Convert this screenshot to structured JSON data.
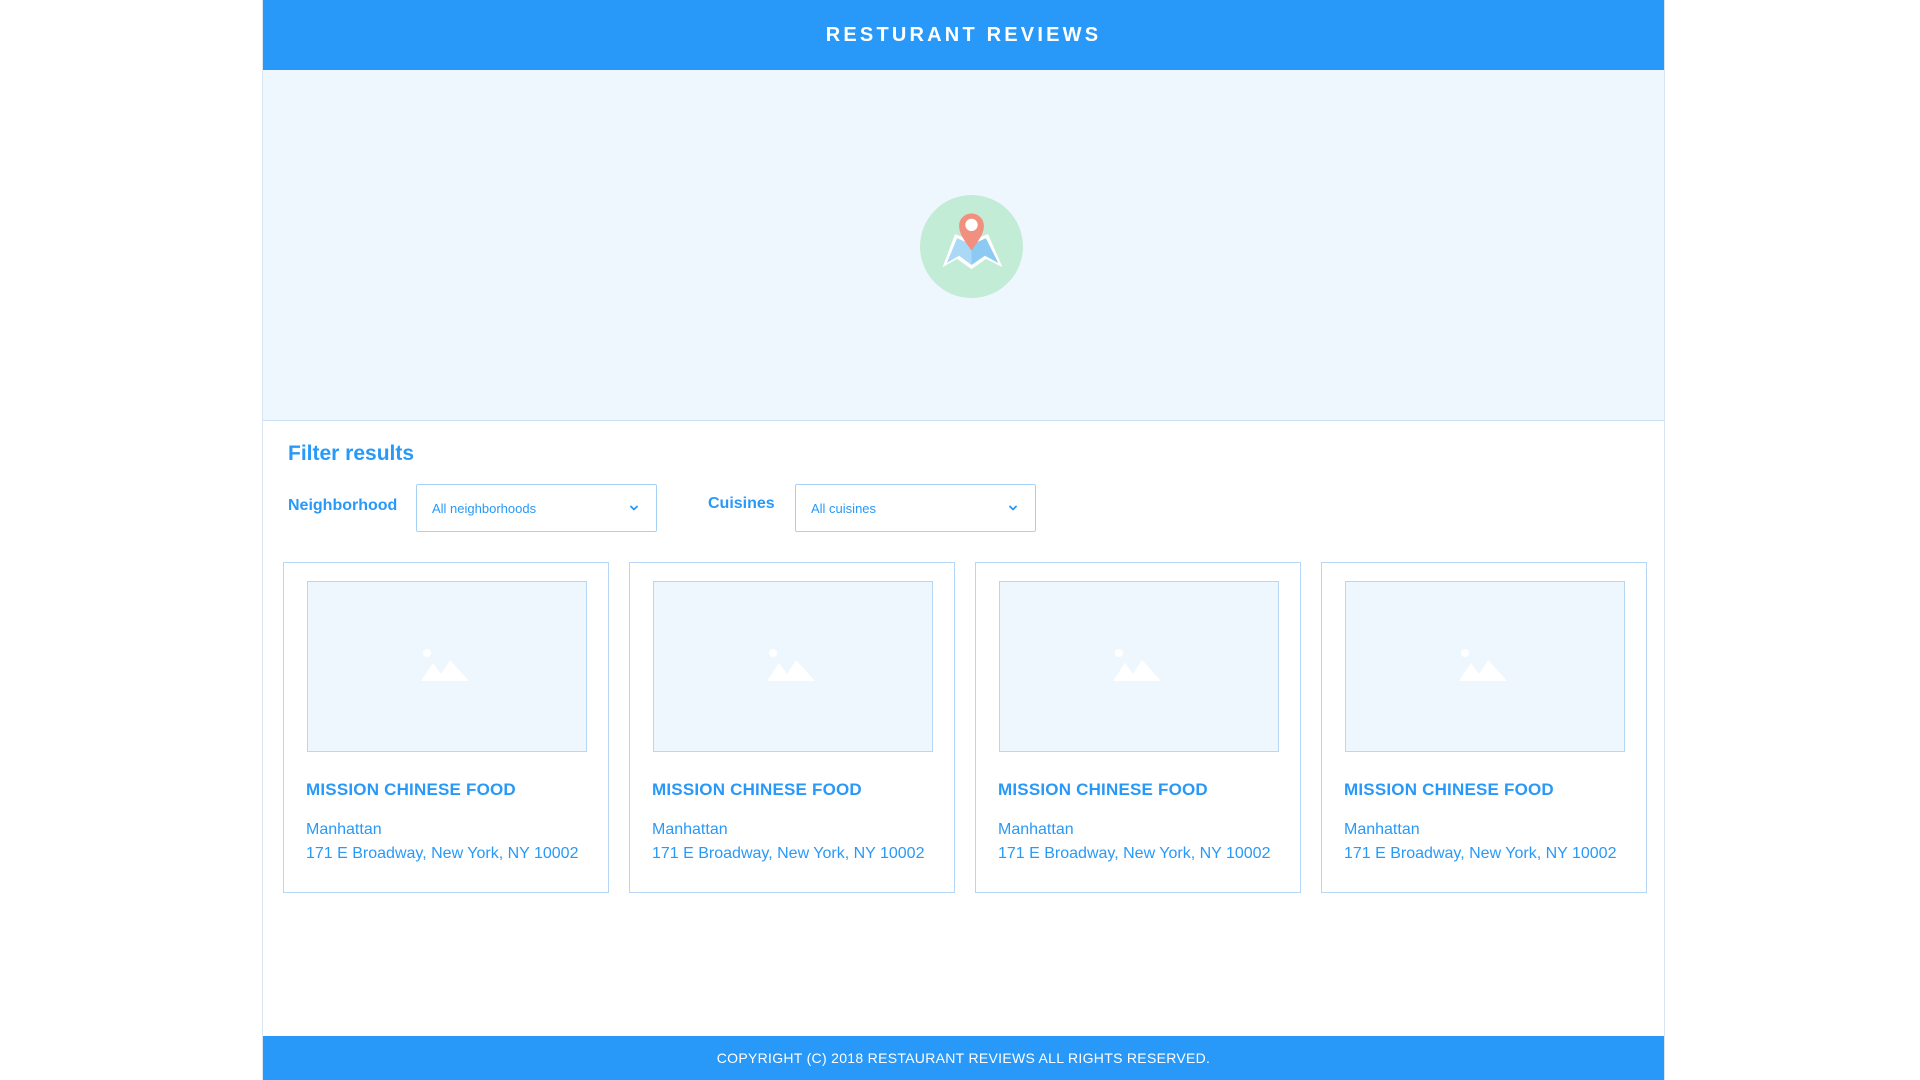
{
  "header": {
    "title": "RESTURANT REVIEWS"
  },
  "map": {
    "icon": "map-pin-icon"
  },
  "filter": {
    "title": "Filter results",
    "neighborhood": {
      "label": "Neighborhood",
      "value": "All neighborhoods"
    },
    "cuisines": {
      "label": "Cuisines",
      "value": "All cuisines"
    }
  },
  "restaurants": [
    {
      "name": "MISSION CHINESE FOOD",
      "neighborhood": "Manhattan",
      "address": "171 E Broadway, New York, NY 10002",
      "image_icon": "image-placeholder-icon"
    },
    {
      "name": "MISSION CHINESE FOOD",
      "neighborhood": "Manhattan",
      "address": "171 E Broadway, New York, NY 10002",
      "image_icon": "image-placeholder-icon"
    },
    {
      "name": "MISSION CHINESE FOOD",
      "neighborhood": "Manhattan",
      "address": "171 E Broadway, New York, NY 10002",
      "image_icon": "image-placeholder-icon"
    },
    {
      "name": "MISSION CHINESE FOOD",
      "neighborhood": "Manhattan",
      "address": "171 E Broadway, New York, NY 10002",
      "image_icon": "image-placeholder-icon"
    }
  ],
  "footer": {
    "copyright": "COPYRIGHT (C) 2018 RESTAURANT REVIEWS ALL RIGHTS RESERVED."
  },
  "colors": {
    "primary": "#2899f8",
    "map_bg": "#eff7fe",
    "pin": "#f29080",
    "pin_circle": "#c3ecd6"
  }
}
